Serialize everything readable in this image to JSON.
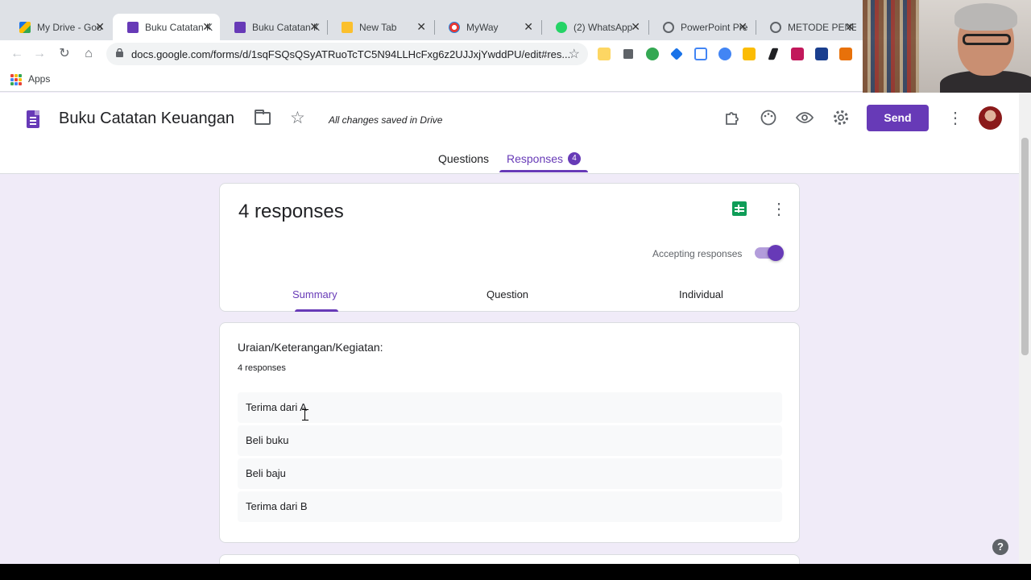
{
  "browser": {
    "tabs": [
      {
        "label": "My Drive - Goo",
        "icon": "google-drive-icon",
        "color": "#1a73e8"
      },
      {
        "label": "Buku Catatan K",
        "icon": "google-forms-icon",
        "color": "#673ab7"
      },
      {
        "label": "Buku Catatan K",
        "icon": "google-forms-icon",
        "color": "#673ab7"
      },
      {
        "label": "New Tab",
        "icon": "sticky-note-icon",
        "color": "#fbc02d"
      },
      {
        "label": "MyWay",
        "icon": "myway-icon",
        "color": "#e53935"
      },
      {
        "label": "(2) WhatsApp",
        "icon": "whatsapp-icon",
        "color": "#25d366"
      },
      {
        "label": "PowerPoint Pre",
        "icon": "globe-icon",
        "color": "#5f6368"
      },
      {
        "label": "METODE PENE",
        "icon": "globe-icon",
        "color": "#5f6368"
      }
    ],
    "close_glyph": "✕",
    "url": "docs.google.com/forms/d/1sqFSQsQSyATRuoTcTC5N94LLHcFxg6z2UJJxjYwddPU/edit#res...",
    "bookmarks_apps_label": "Apps"
  },
  "form_header": {
    "title": "Buku Catatan Keuangan",
    "save_status": "All changes saved in Drive",
    "send_label": "Send",
    "tabs": {
      "questions": "Questions",
      "responses": "Responses"
    },
    "responses_badge": "4"
  },
  "summary_card": {
    "responses_title": "4 responses",
    "accepting_label": "Accepting responses",
    "accepting_responses": true,
    "tabs": {
      "summary": "Summary",
      "question": "Question",
      "individual": "Individual"
    }
  },
  "question_card": {
    "title": "Uraian/Keterangan/Kegiatan:",
    "count": "4 responses",
    "answers": [
      "Terima dari A",
      "Beli buku",
      "Beli baju",
      "Terima dari B"
    ]
  },
  "help": {
    "label": "?"
  },
  "colors": {
    "accent": "#673ab7",
    "background": "#f0ebf8",
    "sheets_green": "#0f9d58"
  }
}
